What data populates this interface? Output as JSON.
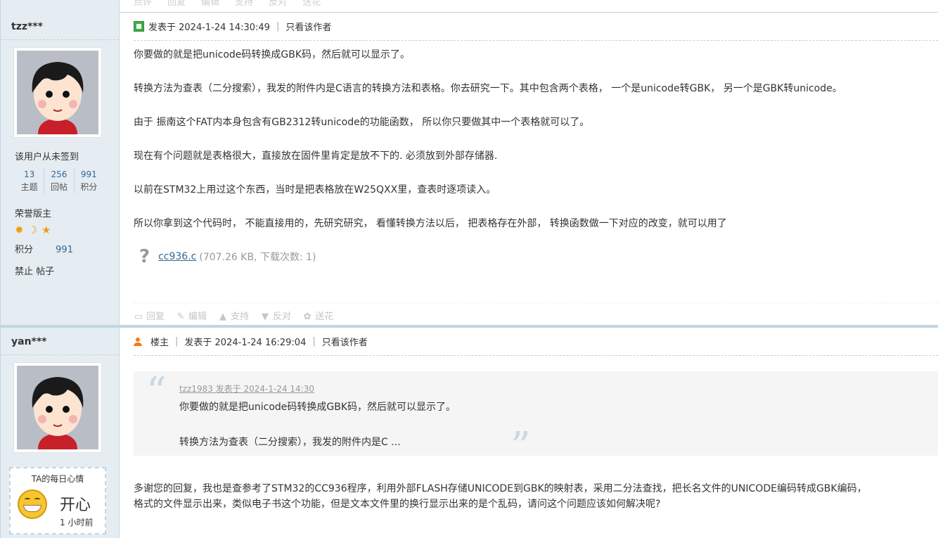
{
  "top_bar": {
    "actions": [
      "点评",
      "回复",
      "编辑",
      "支持",
      "反对",
      "送花"
    ]
  },
  "post1": {
    "username": "tzz***",
    "sign_status": "该用户从未签到",
    "stats": [
      {
        "num": "13",
        "label": "主题"
      },
      {
        "num": "256",
        "label": "回帖"
      },
      {
        "num": "991",
        "label": "积分"
      }
    ],
    "rank": "荣誉版主",
    "points_label": "积分",
    "points_value": "991",
    "ban_label": "禁止 帖子",
    "meta": {
      "posted_at": "发表于 2024-1-24 14:30:49",
      "only_author": "只看该作者"
    },
    "paragraphs": [
      "你要做的就是把unicode码转换成GBK码，然后就可以显示了。",
      "转换方法为查表（二分搜索），我发的附件内是C语言的转换方法和表格。你去研究一下。其中包含两个表格， 一个是unicode转GBK， 另一个是GBK转unicode。",
      "由于 振南这个FAT内本身包含有GB2312转unicode的功能函数， 所以你只要做其中一个表格就可以了。",
      "现在有个问题就是表格很大，直接放在固件里肯定是放不下的. 必须放到外部存储器.",
      "以前在STM32上用过这个东西，当时是把表格放在W25QXX里，查表时逐项读入。",
      "所以你拿到这个代码时， 不能直接用的，先研究研究， 看懂转换方法以后， 把表格存在外部， 转换函数做一下对应的改变，就可以用了"
    ],
    "attachment": {
      "name": "cc936.c",
      "info": "(707.26 KB, 下载次数: 1)"
    },
    "actions": [
      "回复",
      "编辑",
      "支持",
      "反对",
      "送花"
    ]
  },
  "post2": {
    "username": "yan***",
    "meta": {
      "role": "楼主",
      "posted_at": "发表于 2024-1-24 16:29:04",
      "only_author": "只看该作者"
    },
    "quote": {
      "header": "tzz1983 发表于 2024-1-24 14:30",
      "line1": "你要做的就是把unicode码转换成GBK码，然后就可以显示了。",
      "line2": "转换方法为查表（二分搜索），我发的附件内是C ..."
    },
    "reply_line1": "多谢您的回复，我也是查参考了STM32的CC936程序，利用外部FLASH存储UNICODE到GBK的映射表，采用二分法查找，把长名文件的UNICODE编码转成GBK编码，",
    "reply_line2": "格式的文件显示出来，类似电子书这个功能，但是文本文件里的换行显示出来的是个乱码，请问这个问题应该如何解决呢?",
    "mood": {
      "title": "TA的每日心情",
      "mood": "开心",
      "time": "1 小时前"
    }
  },
  "colors": {
    "sidebar_bg": "#e5edf2",
    "border": "#c2d5e3",
    "link": "#336699",
    "muted_action": "#c5c5c5"
  }
}
